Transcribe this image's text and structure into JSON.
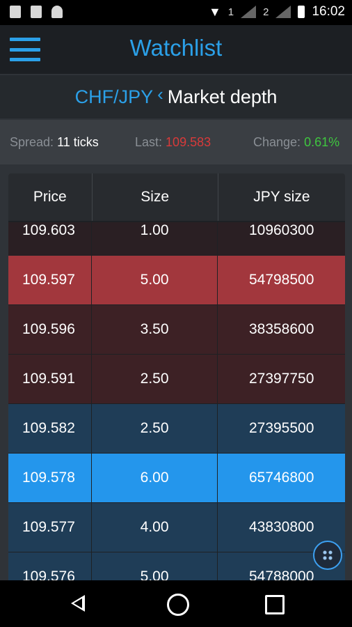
{
  "status_bar": {
    "sim1": "1",
    "sim2": "2",
    "time": "16:02"
  },
  "app_bar": {
    "title": "Watchlist",
    "accent": "#2ba0e8"
  },
  "sub_header": {
    "pair": "CHF/JPY",
    "title": "Market depth"
  },
  "info_bar": {
    "spread_label": "Spread:",
    "spread_value": "11 ticks",
    "last_label": "Last:",
    "last_value": "109.583",
    "change_label": "Change:",
    "change_value": "0.61%"
  },
  "table": {
    "headers": [
      "Price",
      "Size",
      "JPY size"
    ],
    "rows": [
      {
        "price": "109.603",
        "size": "1.00",
        "jpy": "10960300",
        "side": "ask"
      },
      {
        "price": "109.597",
        "size": "5.00",
        "jpy": "54798500",
        "side": "ask-highlight"
      },
      {
        "price": "109.596",
        "size": "3.50",
        "jpy": "38358600",
        "side": "ask"
      },
      {
        "price": "109.591",
        "size": "2.50",
        "jpy": "27397750",
        "side": "ask"
      },
      {
        "price": "109.582",
        "size": "2.50",
        "jpy": "27395500",
        "side": "bid"
      },
      {
        "price": "109.578",
        "size": "6.00",
        "jpy": "65746800",
        "side": "bid-highlight"
      },
      {
        "price": "109.577",
        "size": "4.00",
        "jpy": "43830800",
        "side": "bid"
      },
      {
        "price": "109.576",
        "size": "5.00",
        "jpy": "54788000",
        "side": "bid"
      }
    ]
  },
  "icons": {
    "menu": "hamburger-menu-icon",
    "back": "chevron-left-icon",
    "fab": "grid-dots-icon",
    "nav_back": "triangle-back-icon",
    "nav_home": "circle-home-icon",
    "nav_recent": "square-recent-icon"
  }
}
